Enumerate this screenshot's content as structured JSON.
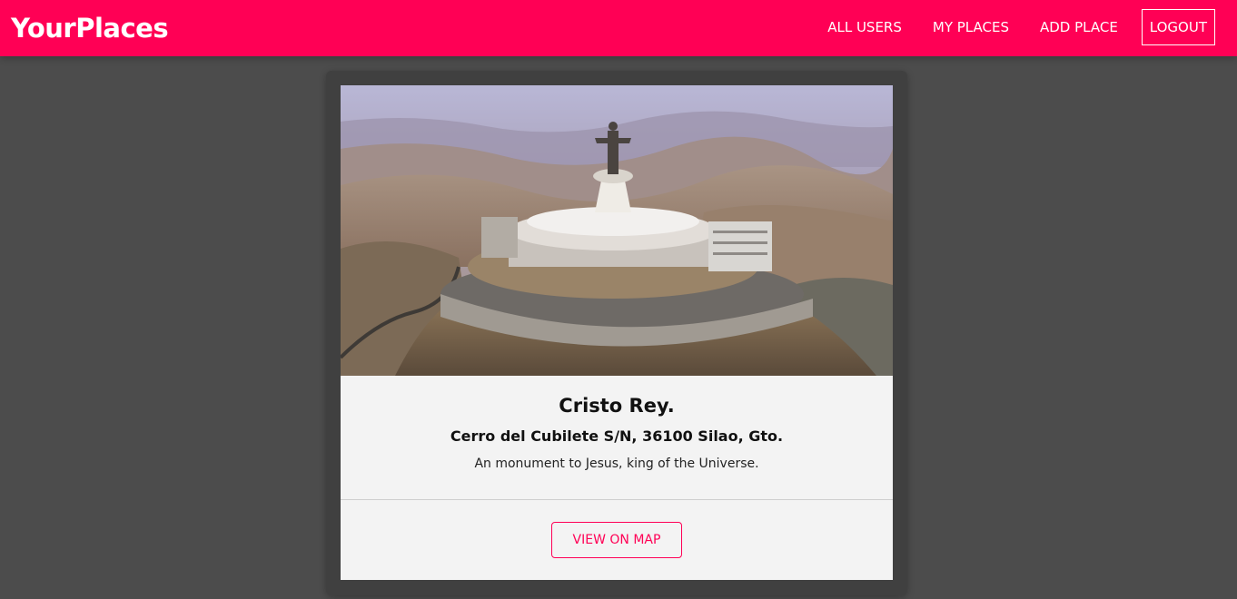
{
  "header": {
    "logo": "YourPlaces",
    "nav": {
      "all_users": "ALL USERS",
      "my_places": "MY PLACES",
      "add_place": "ADD PLACE",
      "logout": "LOGOUT"
    }
  },
  "place": {
    "title": "Cristo Rey.",
    "address": "Cerro del Cubilete S/N, 36100 Silao, Gto.",
    "description": "An monument to Jesus, king of the Universe.",
    "view_on_map_label": "VIEW ON MAP"
  },
  "colors": {
    "brand": "#ff0055",
    "background": "#4c4c4c",
    "card": "#f3f3f3"
  }
}
